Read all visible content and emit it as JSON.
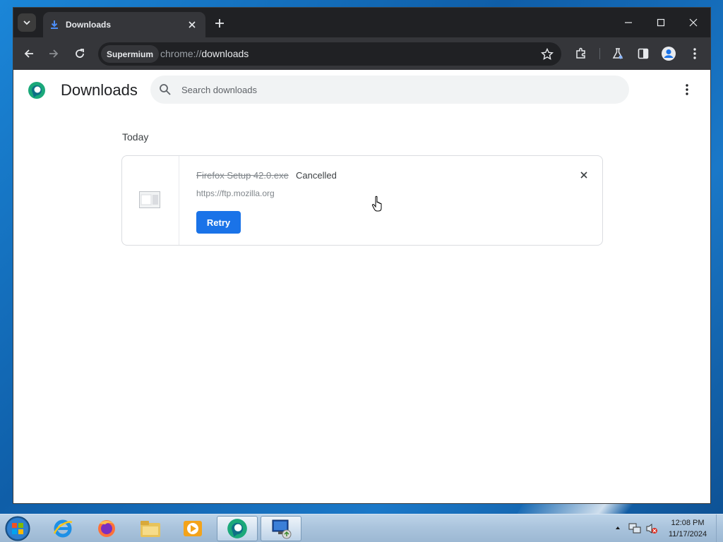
{
  "browser": {
    "tab_title": "Downloads",
    "site_chip": "Supermium",
    "url_scheme": "chrome://",
    "url_host": "downloads"
  },
  "page": {
    "title": "Downloads",
    "search_placeholder": "Search downloads"
  },
  "downloads": {
    "date_header": "Today",
    "items": [
      {
        "filename": "Firefox Setup 42.0.exe",
        "status": "Cancelled",
        "url": "https://ftp.mozilla.org",
        "action_label": "Retry"
      }
    ]
  },
  "taskbar": {
    "apps": [
      "internet-explorer",
      "firefox",
      "file-explorer",
      "media-player",
      "supermium",
      "remote-desktop"
    ],
    "clock_time": "12:08 PM",
    "clock_date": "11/17/2024"
  },
  "colors": {
    "accent": "#1a73e8",
    "toolbar": "#35363a",
    "tabstrip": "#202124"
  }
}
